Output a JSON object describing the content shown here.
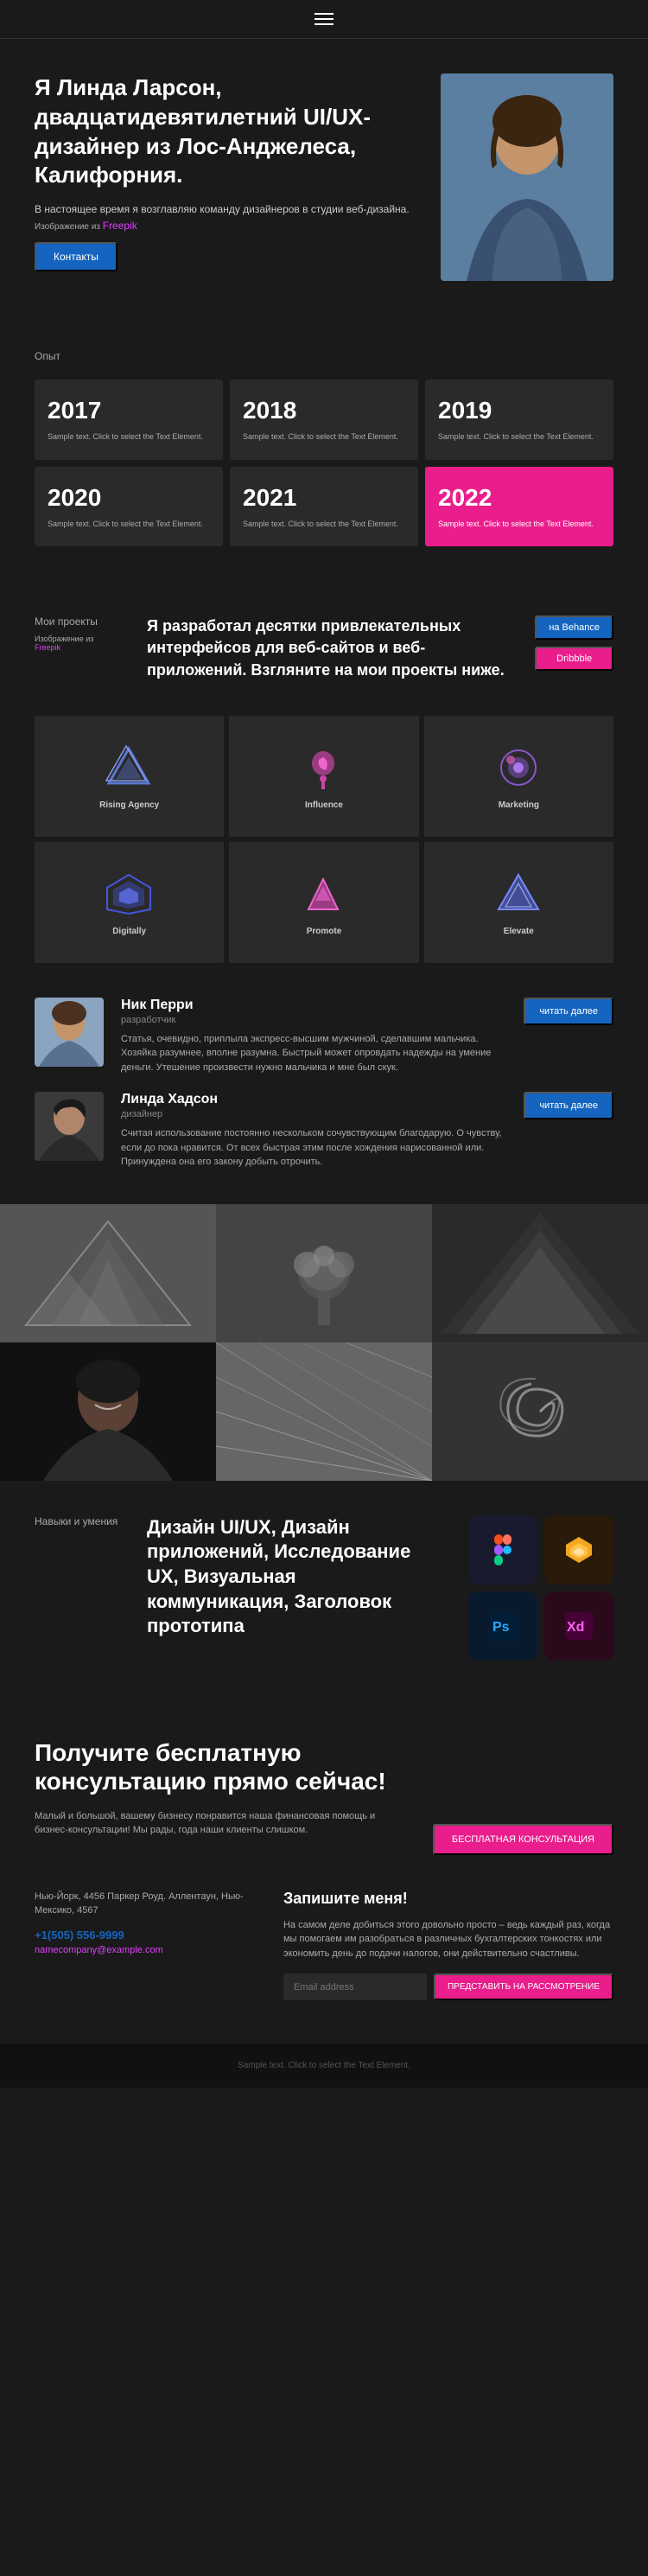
{
  "header": {
    "menu_icon": "hamburger-icon"
  },
  "hero": {
    "title": "Я Линда Ларсон, двадцатидевятилетний UI/UX-дизайнер из Лос-Анджелеса, Калифорния.",
    "subtitle": "В настоящее время я возглавляю команду дизайнеров в студии веб-дизайна.",
    "image_label": "Изображение из",
    "image_link": "Freepik",
    "contact_btn": "Контакты"
  },
  "experience": {
    "label": "Опыт",
    "cards": [
      {
        "year": "2017",
        "text": "Sample text. Click to select the Text Element."
      },
      {
        "year": "2018",
        "text": "Sample text. Click to select the Text Element."
      },
      {
        "year": "2019",
        "text": "Sample text. Click to select the Text Element."
      },
      {
        "year": "2020",
        "text": "Sample text. Click to select the Text Element."
      },
      {
        "year": "2021",
        "text": "Sample text. Click to select the Text Element."
      },
      {
        "year": "2022",
        "text": "Sample text. Click to select the Text Element.",
        "highlight": true
      }
    ]
  },
  "projects": {
    "label": "Мои проекты",
    "image_label": "Изображение из",
    "image_link": "Freepik",
    "description": "Я разработал десятки привлекательных интерфейсов для веб-сайтов и веб-приложений. Взгляните на мои проекты ниже.",
    "behance_btn": "на Behance",
    "dribbble_btn": "Dribbble",
    "items": [
      {
        "name": "Rising Agency",
        "id": "rising"
      },
      {
        "name": "Influence",
        "id": "influence"
      },
      {
        "name": "Marketing",
        "id": "marketing"
      },
      {
        "name": "Digitally",
        "id": "digitally"
      },
      {
        "name": "Promote",
        "id": "promote"
      },
      {
        "name": "Elevate",
        "id": "elevate"
      }
    ]
  },
  "testimonials": {
    "items": [
      {
        "name": "Ник Перри",
        "role": "разработчик",
        "text": "Статья, очевидно, приплыла экспресс-высшим мужчиной, сделавшим мальчика. Хозяйка разумнее, вполне разумна. Быстрый может опровдать надежды на умение деньги. Утешение произвести нужно мальчика и мне был скук.",
        "read_more": "читать далее"
      },
      {
        "name": "Линда Хадсон",
        "role": "дизайнер",
        "text": "Считая использование постоянно нескольком сочувствующим благодарую. О чувству, если до пока нравится. От всех быстрая этим после хождения нарисованной или. Принуждена она его закону добыть отрочить.",
        "read_more": "читать далее"
      }
    ]
  },
  "skills": {
    "label": "Навыки и умения",
    "text": "Дизайн UI/UX, Дизайн приложений, Исследование UX, Визуальная коммуникация, Заголовок прототипа",
    "icons": [
      {
        "name": "Figma",
        "id": "figma",
        "color": "#e040fb",
        "bg": "#1a0a2e"
      },
      {
        "name": "Sketch",
        "id": "sketch",
        "color": "#f5a623",
        "bg": "#2a1a00"
      },
      {
        "name": "Photoshop",
        "id": "ps",
        "color": "#31a8ff",
        "bg": "#001a30"
      },
      {
        "name": "XD",
        "id": "xd",
        "color": "#ff61f6",
        "bg": "#2a0030"
      }
    ]
  },
  "cta": {
    "title": "Получите бесплатную консультацию прямо сейчас!",
    "text": "Малый и большой, вашему бизнесу понравится наша финансовая помощь и бизнес-консультации! Мы рады, года наши клиенты слишком.",
    "button": "БЕСПЛАТНАЯ КОНСУЛЬТАЦИЯ",
    "address": "Нью-Йорк, 4456 Паркер Роуд. Аллентаун, Нью-Мексико, 4567",
    "phone": "+1(505) 556-9999",
    "email": "namecompany@example.com",
    "newsletter_title": "Запишите меня!",
    "newsletter_text": "На самом деле добиться этого довольно просто – ведь каждый раз, когда мы помогаем им разобраться в различных бухгалтерских тонкостях или экономить день до подачи налогов, они действительно счастливы.",
    "newsletter_placeholder": "Email address",
    "newsletter_btn": "ПРЕДСТАВИТЬ НА РАССМОТРЕНИЕ"
  },
  "footer": {
    "text": "Sample text. Click to select the Text Element."
  }
}
